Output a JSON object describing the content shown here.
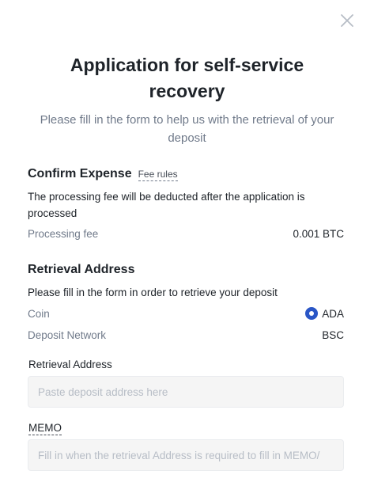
{
  "dialog": {
    "title": "Application for self-service recovery",
    "subtitle": "Please fill in the form to help us with the retrieval of your deposit"
  },
  "confirm_expense": {
    "heading": "Confirm Expense",
    "fee_rules_link": "Fee rules",
    "note": "The processing fee will be deducted after the application is processed",
    "processing_fee_label": "Processing fee",
    "processing_fee_value": "0.001 BTC"
  },
  "retrieval": {
    "heading": "Retrieval Address",
    "note": "Please fill in the form in order to retrieve your deposit",
    "coin_label": "Coin",
    "coin_value": "ADA",
    "coin_icon": "ada-coin-icon",
    "coin_color": "#2a56c6",
    "network_label": "Deposit Network",
    "network_value": "BSC"
  },
  "form": {
    "address_label": "Retrieval Address",
    "address_placeholder": "Paste deposit address here",
    "memo_label": "MEMO",
    "memo_placeholder": "Fill in when the retrieval Address is required to fill in MEMO/"
  },
  "icons": {
    "close": "close-icon"
  }
}
